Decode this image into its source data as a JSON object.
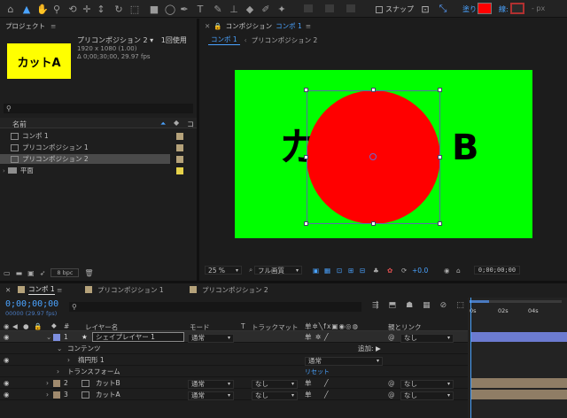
{
  "toolbar": {
    "snap_label": "スナップ",
    "fill_label": "塗り:",
    "stroke_label": "線:",
    "px_label": "- px",
    "fill_color": "#ff0000"
  },
  "project": {
    "title": "プロジェクト",
    "thumb_text": "カットA",
    "item_name": "プリコンポジション 2 ▾",
    "usage": "1回使用",
    "dims": "1920 x 1080 (1.00)",
    "duration": "Δ 0;00;30;00, 29.97 fps",
    "search_placeholder": "",
    "col_name": "名前",
    "col_type": "コ",
    "items": [
      {
        "label": "コンポ 1",
        "kind": "comp"
      },
      {
        "label": "プリコンポジション 1",
        "kind": "comp"
      },
      {
        "label": "プリコンポジション 2",
        "kind": "comp"
      },
      {
        "label": "平面",
        "kind": "folder"
      }
    ],
    "bpc": "8 bpc"
  },
  "composition": {
    "panel_title": "コンポジション",
    "panel_title_accent": "コンポ 1",
    "tabs": [
      "コンポ 1",
      "プリコンポジション 2"
    ],
    "canvas_text_left": "カ",
    "canvas_text_right": "B",
    "bg_color": "#00ff00",
    "circle_color": "#ff0000",
    "zoom": "25 %",
    "quality": "フル画質",
    "exposure": "+0.0",
    "timecode": "0;00;00;00"
  },
  "timeline": {
    "tabs": [
      "コンポ 1",
      "プリコンポジション 1",
      "プリコンポジション 2"
    ],
    "timecode": "0;00;00;00",
    "frames": "00000 (29.97 fps)",
    "search_placeholder": "",
    "col_num": "#",
    "col_layer_name": "レイヤー名",
    "col_mode": "モード",
    "col_t": "T",
    "col_trackmatte": "トラックマット",
    "col_parent": "親とリンク",
    "ruler": [
      "0s",
      "02s",
      "04s"
    ],
    "layers": [
      {
        "num": "1",
        "name": "シェイプレイヤー 1",
        "mode": "通常",
        "trackmatte": "",
        "parent": "なし",
        "color": "#7e8fe0"
      },
      {
        "num": "2",
        "name": "カットB",
        "mode": "通常",
        "trackmatte": "なし",
        "parent": "なし",
        "color": "#a08a6e"
      },
      {
        "num": "3",
        "name": "カットA",
        "mode": "通常",
        "trackmatte": "なし",
        "parent": "なし",
        "color": "#a08a6e"
      }
    ],
    "contents_label": "コンテンツ",
    "add_label": "追加:",
    "ellipse_label": "楕円形 1",
    "ellipse_mode": "通常",
    "transform_label": "トランスフォーム",
    "reset_label": "リセット"
  }
}
